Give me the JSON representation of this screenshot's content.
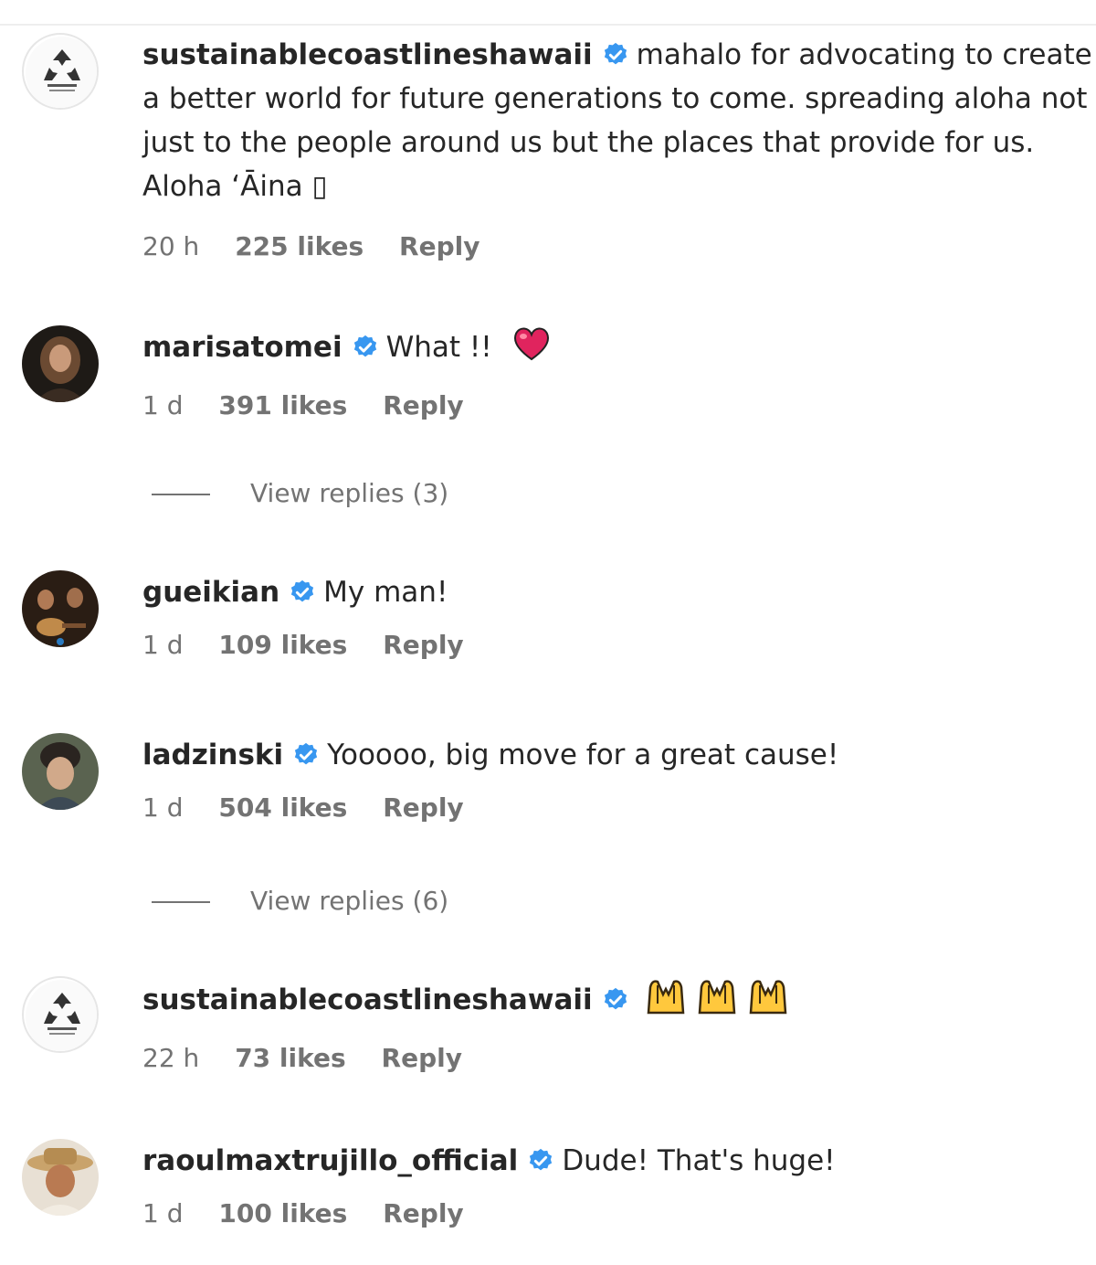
{
  "comments": [
    {
      "username": "sustainablecoastlineshawaii",
      "text": "mahalo for advocating to create a better world for future generations to come. spreading aloha not just to the people around us but the places that provide for us. Aloha ʻĀina ▯",
      "time": "20 h",
      "likes": "225 likes",
      "reply": "Reply",
      "avatar": "recycle-logo"
    },
    {
      "username": "marisatomei",
      "text": "What !!",
      "emoji": "red-heart",
      "time": "1 d",
      "likes": "391 likes",
      "reply": "Reply",
      "avatar": "portrait",
      "view_replies": "View replies (3)"
    },
    {
      "username": "gueikian",
      "text": "My man!",
      "time": "1 d",
      "likes": "109 likes",
      "reply": "Reply",
      "avatar": "guitar-photo"
    },
    {
      "username": "ladzinski",
      "text": "Yooooo, big move for a great cause!",
      "time": "1 d",
      "likes": "504 likes",
      "reply": "Reply",
      "avatar": "portrait",
      "view_replies": "View replies (6)"
    },
    {
      "username": "sustainablecoastlineshawaii",
      "text": "",
      "emoji": "raising-hands x3",
      "time": "22 h",
      "likes": "73 likes",
      "reply": "Reply",
      "avatar": "recycle-logo"
    },
    {
      "username": "raoulmaxtrujillo_official",
      "text": "Dude! That's huge!",
      "time": "1 d",
      "likes": "100 likes",
      "reply": "Reply",
      "avatar": "hat-portrait"
    }
  ],
  "colors": {
    "verified": "#3897f0",
    "heart": "#e0245e",
    "meta": "#737373",
    "text": "#262626"
  },
  "icons": [
    "verified-badge-icon",
    "red-heart-emoji",
    "raising-hands-emoji"
  ]
}
